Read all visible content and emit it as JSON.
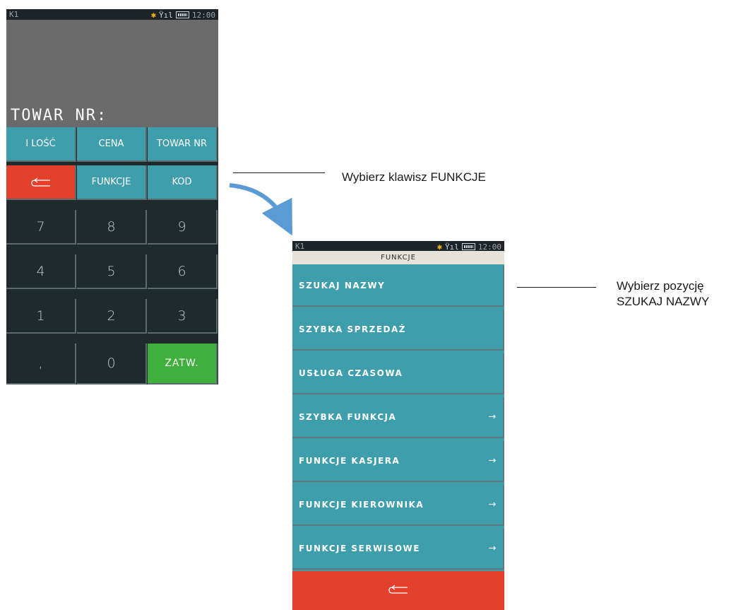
{
  "screen1": {
    "status_label": "K1",
    "clock": "12:00",
    "display_text": "TOWAR NR:",
    "keys": {
      "ilosc": "I LOŚĆ",
      "cena": "CENA",
      "towar_nr": "TOWAR NR",
      "funkcje": "FUNKCJE",
      "kod": "KOD",
      "k7": "7",
      "k8": "8",
      "k9": "9",
      "k4": "4",
      "k5": "5",
      "k6": "6",
      "k1": "1",
      "k2": "2",
      "k3": "3",
      "comma": ",",
      "k0": "0",
      "zatw": "ZATW."
    }
  },
  "screen2": {
    "status_label": "K1",
    "clock": "12:00",
    "header": "FUNKCJE",
    "menu": [
      {
        "label": "SZUKAJ NAZWY",
        "arrow": ""
      },
      {
        "label": "SZYBKA SPRZEDAŻ",
        "arrow": ""
      },
      {
        "label": "USŁUGA CZASOWA",
        "arrow": ""
      },
      {
        "label": "SZYBKA FUNKCJA",
        "arrow": "→"
      },
      {
        "label": "FUNKCJE KASJERA",
        "arrow": "→"
      },
      {
        "label": "FUNKCJE KIEROWNIKA",
        "arrow": "→"
      },
      {
        "label": "FUNKCJE SERWISOWE",
        "arrow": "→"
      }
    ]
  },
  "annotations": {
    "step1": "Wybierz klawisz FUNKCJE",
    "step2_line1": "Wybierz pozycję",
    "step2_line2": "SZUKAJ NAZWY"
  },
  "colors": {
    "teal": "#3f9eac",
    "red": "#e2402b",
    "green": "#3fb03c",
    "dark": "#1e2a2c",
    "arrow": "#5b9bd5"
  },
  "icons": [
    "bluetooth-icon",
    "signal-icon",
    "battery-icon",
    "back-arrow-icon",
    "chevron-right-icon"
  ]
}
